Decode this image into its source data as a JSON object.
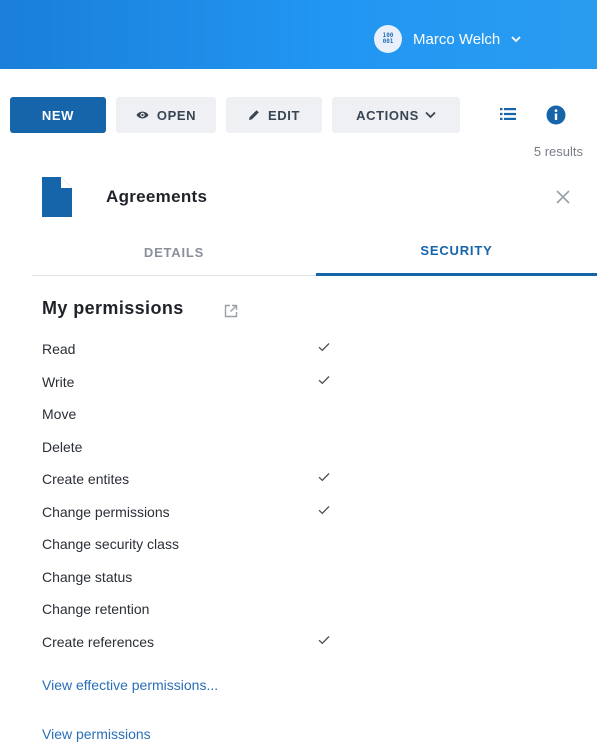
{
  "user": {
    "avatar_text": "100\n001",
    "name": "Marco Welch"
  },
  "toolbar": {
    "new_label": "NEW",
    "open_label": "OPEN",
    "edit_label": "EDIT",
    "actions_label": "ACTIONS"
  },
  "results_text": "5 results",
  "panel": {
    "title": "Agreements"
  },
  "tabs": [
    {
      "label": "DETAILS",
      "active": false
    },
    {
      "label": "SECURITY",
      "active": true
    }
  ],
  "permissions": {
    "title": "My permissions",
    "items": [
      {
        "label": "Read",
        "granted": true
      },
      {
        "label": "Write",
        "granted": true
      },
      {
        "label": "Move",
        "granted": false
      },
      {
        "label": "Delete",
        "granted": false
      },
      {
        "label": "Create entites",
        "granted": true
      },
      {
        "label": "Change permissions",
        "granted": true
      },
      {
        "label": "Change security class",
        "granted": false
      },
      {
        "label": "Change status",
        "granted": false
      },
      {
        "label": "Change retention",
        "granted": false
      },
      {
        "label": "Create references",
        "granted": true
      }
    ]
  },
  "links": {
    "effective": "View effective permissions...",
    "view": "View permissions"
  },
  "colors": {
    "primary": "#1664a9",
    "topbar": "#2196f3",
    "link": "#2a6fb8"
  }
}
